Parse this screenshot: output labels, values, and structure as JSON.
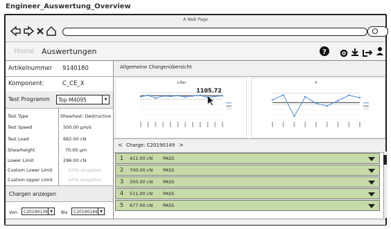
{
  "document": {
    "title": "Engineer_Auswertung_Overview"
  },
  "browser": {
    "page_title": "A Web Page"
  },
  "header": {
    "breadcrumb_home": "Home",
    "breadcrumb_current": "Auswertungen",
    "icons": [
      "help-icon",
      "settings-icon",
      "download-icon",
      "logout-icon",
      "user-icon"
    ]
  },
  "left_panel": {
    "article_label": "Artikelnummer",
    "article_value": "9140180",
    "component_label": "Komponent:",
    "component_value": "C_CE_X",
    "program_label": "Test Programm",
    "program_value": "Top-M4095",
    "specs": [
      {
        "label": "Test Type",
        "value": "Sheartest: Destructive"
      },
      {
        "label": "Test Speed",
        "value": "500.00 µm/s"
      },
      {
        "label": "Test Load",
        "value": "662.00 cN"
      },
      {
        "label": "Shearheight",
        "value": "70.00 µm"
      },
      {
        "label": "Lower Limit",
        "value": "296.00 cN"
      },
      {
        "label": "Custom Lower Limit",
        "placeholder": "bitte eingeben"
      },
      {
        "label": "Custom Upper Limit",
        "placeholder": "bitte eingeben"
      }
    ],
    "show_batches": "Chargen anzeigen",
    "from_label": "Von",
    "from_value": "C20190139",
    "to_label": "Bis",
    "to_value": "C20190149"
  },
  "main": {
    "overview_title": "Allgemeine Chargenübersicht",
    "charge_label": "Charge: C20190149",
    "charge_prev": "<",
    "charge_next": ">",
    "rows": [
      {
        "n": "1",
        "value": "411.00 cN",
        "status": "PASS"
      },
      {
        "n": "2",
        "value": "700.00 cN",
        "status": "PASS"
      },
      {
        "n": "3",
        "value": "350.00 cN",
        "status": "PASS"
      },
      {
        "n": "4",
        "value": "511.00 cN",
        "status": "PASS"
      },
      {
        "n": "5",
        "value": "677.00 cN",
        "status": "PASS"
      }
    ]
  },
  "chart_data": [
    {
      "type": "line",
      "title": "x-Bar",
      "annotation": "1105.72",
      "ylim": [
        400,
        1300
      ],
      "series": [
        {
          "color": "#4a90d9",
          "values": [
            1080,
            1120,
            1040,
            1100,
            1090,
            1110,
            1070,
            1100,
            1120,
            1060,
            1090,
            1105
          ]
        }
      ],
      "reference_lines": [
        1110,
        1200,
        1000
      ]
    },
    {
      "type": "line",
      "title": "S",
      "ylim": [
        0,
        800
      ],
      "series": [
        {
          "color": "#4a90d9",
          "values": [
            520,
            650,
            90,
            600,
            430,
            360,
            500,
            640,
            580
          ]
        }
      ],
      "reference_lines": [
        450,
        400,
        700
      ]
    }
  ]
}
